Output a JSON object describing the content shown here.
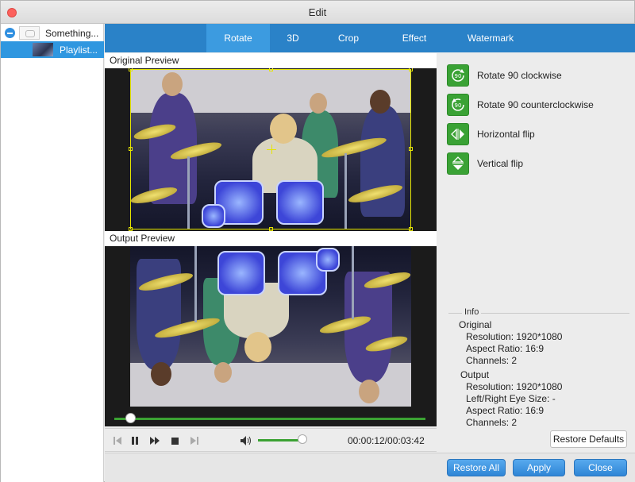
{
  "window": {
    "title": "Edit"
  },
  "sidebar": {
    "items": [
      {
        "label": "Something..."
      },
      {
        "label": "Playlist..."
      }
    ]
  },
  "tabs": [
    {
      "label": "Rotate",
      "active": true
    },
    {
      "label": "3D"
    },
    {
      "label": "Crop"
    },
    {
      "label": "Effect"
    },
    {
      "label": "Watermark"
    }
  ],
  "preview": {
    "original_label": "Original Preview",
    "output_label": "Output Preview"
  },
  "player": {
    "progress": 0.05,
    "volume": 0.9,
    "timecode": "00:00:12/00:03:42"
  },
  "actions": [
    {
      "label": "Rotate 90 clockwise",
      "icon": "rotate-cw-icon"
    },
    {
      "label": "Rotate 90 counterclockwise",
      "icon": "rotate-ccw-icon"
    },
    {
      "label": "Horizontal flip",
      "icon": "horizontal-flip-icon"
    },
    {
      "label": "Vertical flip",
      "icon": "vertical-flip-icon"
    }
  ],
  "info": {
    "legend": "Info",
    "original": {
      "heading": "Original",
      "resolution": "Resolution: 1920*1080",
      "aspect_ratio": "Aspect Ratio: 16:9",
      "channels": "Channels: 2"
    },
    "output": {
      "heading": "Output",
      "resolution": "Resolution: 1920*1080",
      "eye_size": "Left/Right Eye Size: -",
      "aspect_ratio": "Aspect Ratio: 16:9",
      "channels": "Channels: 2"
    }
  },
  "buttons": {
    "restore_defaults": "Restore Defaults",
    "restore_all": "Restore All",
    "apply": "Apply",
    "close": "Close"
  },
  "colors": {
    "tabbar": "#2a82c8",
    "tab_active": "#3c9be0",
    "action_green": "#3aa235",
    "button_blue": "#2f86d6",
    "crop_yellow": "#e5e500"
  }
}
